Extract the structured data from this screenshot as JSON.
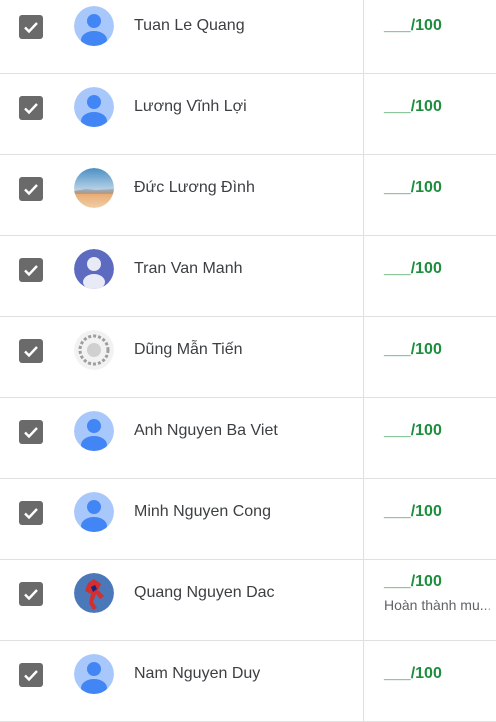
{
  "students": [
    {
      "name": "Tuan Le Quang",
      "grade": "___/100",
      "avatar": "default-avatar"
    },
    {
      "name": "Lương Vĩnh Lợi",
      "grade": "___/100",
      "avatar": "default-avatar"
    },
    {
      "name": "Đức Lương Đình",
      "grade": "___/100",
      "avatar": "landscape-photo-avatar"
    },
    {
      "name": "Tran Van Manh",
      "grade": "___/100",
      "avatar": "purple-user-avatar"
    },
    {
      "name": "Dũng Mẫn Tiến",
      "grade": "___/100",
      "avatar": "sketch-photo-avatar"
    },
    {
      "name": "Anh Nguyen Ba Viet",
      "grade": "___/100",
      "avatar": "default-avatar"
    },
    {
      "name": "Minh Nguyen Cong",
      "grade": "___/100",
      "avatar": "default-avatar"
    },
    {
      "name": "Quang Nguyen Dac",
      "grade": "___/100",
      "status": "Hoàn thành mu...",
      "avatar": "spiderman-photo-avatar"
    },
    {
      "name": "Nam Nguyen Duy",
      "grade": "___/100",
      "avatar": "default-avatar"
    }
  ],
  "colors": {
    "grade": "#1e8e3e",
    "checkbox": "#6a6a6a",
    "avatar_default_bg": "#a8c7fa",
    "avatar_default_fg": "#4285f4"
  }
}
